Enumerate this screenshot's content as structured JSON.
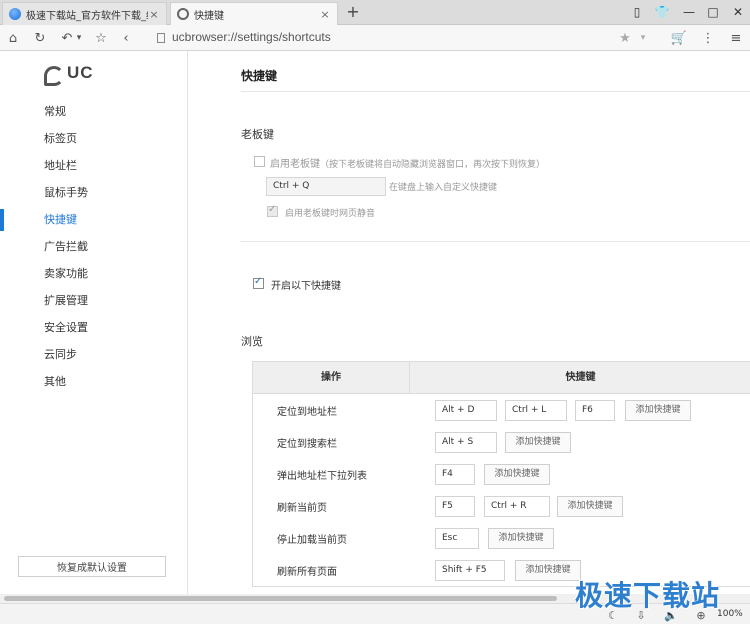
{
  "tabs": [
    {
      "title": "极速下载站_官方软件下载_绿色",
      "active": false
    },
    {
      "title": "快捷键",
      "active": true
    }
  ],
  "address": {
    "url": "ucbrowser://settings/shortcuts"
  },
  "sidebar": {
    "logo_text": "UC",
    "items": [
      {
        "label": "常规"
      },
      {
        "label": "标签页"
      },
      {
        "label": "地址栏"
      },
      {
        "label": "鼠标手势"
      },
      {
        "label": "快捷键",
        "active": true
      },
      {
        "label": "广告拦截"
      },
      {
        "label": "卖家功能"
      },
      {
        "label": "扩展管理"
      },
      {
        "label": "安全设置"
      },
      {
        "label": "云同步"
      },
      {
        "label": "其他"
      }
    ],
    "restore_label": "恢复成默认设置"
  },
  "main": {
    "title": "快捷键",
    "boss_key": {
      "section_title": "老板键",
      "enable_label": "启用老板键",
      "enable_note": "（按下老板键将自动隐藏浏览器窗口，再次按下则恢复）",
      "enable_checked": false,
      "key_value": "Ctrl + Q",
      "key_hint": "在键盘上输入自定义快捷键",
      "mute_label": "启用老板键时网页静音",
      "mute_checked": true
    },
    "enable_shortcuts": {
      "label": "开启以下快捷键",
      "checked": true
    },
    "browse": {
      "section_title": "浏览",
      "col_action": "操作",
      "col_shortcut": "快捷键",
      "add_label": "添加快捷键",
      "rows": [
        {
          "action": "定位到地址栏",
          "keys": [
            "Alt + D",
            "Ctrl + L",
            "F6"
          ]
        },
        {
          "action": "定位到搜索栏",
          "keys": [
            "Alt + S"
          ]
        },
        {
          "action": "弹出地址栏下拉列表",
          "keys": [
            "F4"
          ]
        },
        {
          "action": "刷新当前页",
          "keys": [
            "F5",
            "Ctrl + R"
          ]
        },
        {
          "action": "停止加载当前页",
          "keys": [
            "Esc"
          ]
        },
        {
          "action": "刷新所有页面",
          "keys": [
            "Shift + F5"
          ]
        }
      ]
    }
  },
  "statusbar": {
    "zoom": "100%"
  },
  "watermark": "极速下载站",
  "colors": {
    "accent": "#1e78d6",
    "watermark": "#2f7fcf"
  }
}
